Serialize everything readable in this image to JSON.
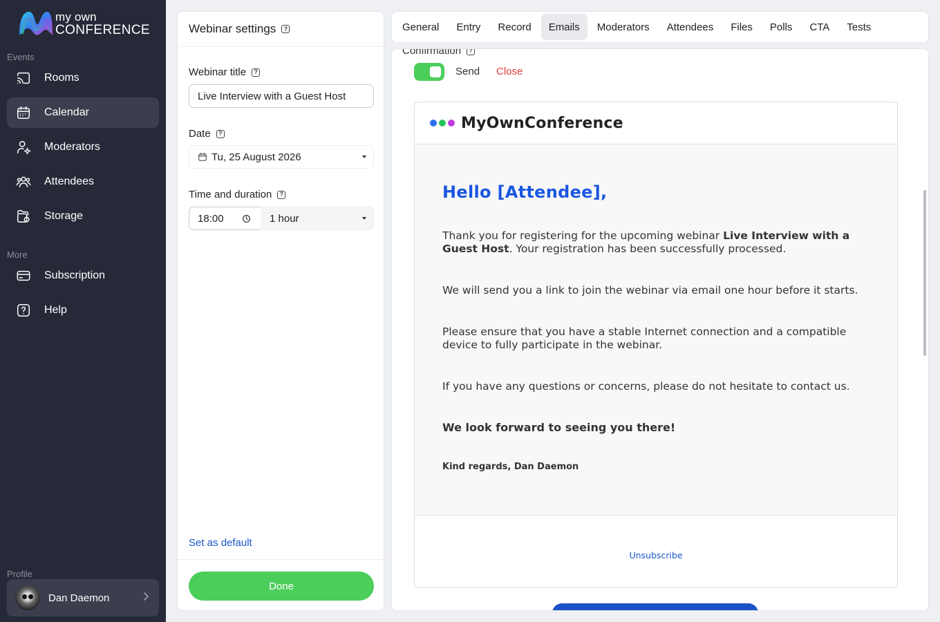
{
  "app": {
    "logo_line1": "my own",
    "logo_line2": "CONFERENCE"
  },
  "sidebar": {
    "events_label": "Events",
    "more_label": "More",
    "profile_label": "Profile",
    "items": [
      {
        "label": "Rooms",
        "icon": "cast-icon"
      },
      {
        "label": "Calendar",
        "icon": "calendar-icon",
        "active": true
      },
      {
        "label": "Moderators",
        "icon": "moderator-icon"
      },
      {
        "label": "Attendees",
        "icon": "attendees-icon"
      },
      {
        "label": "Storage",
        "icon": "folder-icon"
      }
    ],
    "more_items": [
      {
        "label": "Subscription",
        "icon": "card-icon"
      },
      {
        "label": "Help",
        "icon": "help-icon"
      }
    ],
    "profile_name": "Dan Daemon"
  },
  "settings": {
    "title": "Webinar settings",
    "title_label": "Webinar title",
    "title_value": "Live Interview with a Guest Host",
    "date_label": "Date",
    "date_value": "Tu, 25 August 2026",
    "time_label": "Time and duration",
    "time_value": "18:00",
    "duration_value": "1 hour",
    "set_default": "Set as default",
    "done": "Done",
    "help_glyph": "?"
  },
  "tabs": [
    "General",
    "Entry",
    "Record",
    "Emails",
    "Moderators",
    "Attendees",
    "Files",
    "Polls",
    "CTA",
    "Tests"
  ],
  "active_tab": "Emails",
  "editor": {
    "section_label": "Confirmation",
    "send_label": "Send",
    "close_label": "Close",
    "toggle_on": true
  },
  "email": {
    "brand": "MyOwnConference",
    "dot_colors": [
      "#2f6df0",
      "#28c45a",
      "#c13ae0"
    ],
    "greeting": "Hello [Attendee],",
    "p1_before": "Thank you for registering for the upcoming webinar ",
    "p1_bold": "Live Interview with a Guest Host",
    "p1_after": ". Your registration has been successfully processed.",
    "p2": "We will send you a link to join the webinar via email one hour before it starts.",
    "p3": "Please ensure that you have a stable Internet connection and a compatible device to fully participate in the webinar.",
    "p4": "If you have any questions or concerns, please do not hesitate to contact us.",
    "closing": "We look forward to seeing you there!",
    "regards": "Kind regards, Dan Daemon",
    "unsubscribe": "Unsubscribe"
  },
  "colors": {
    "sidebar_bg": "#262a38",
    "accent_green": "#4cce5b",
    "link_blue": "#1a57c8",
    "greeting_blue": "#1a56e0",
    "close_red": "#e03d3d"
  }
}
